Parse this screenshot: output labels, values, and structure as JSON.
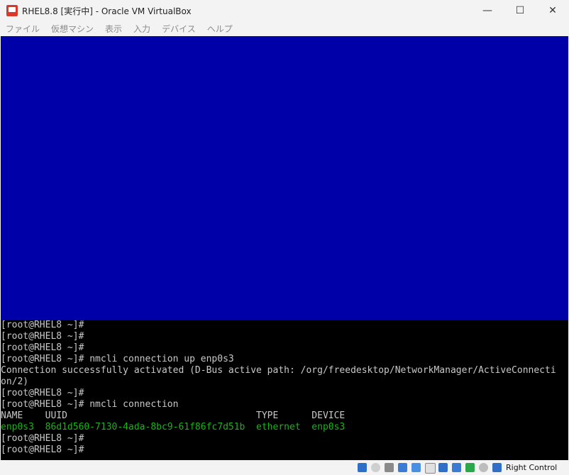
{
  "window": {
    "title": "RHEL8.8 [実行中] - Oracle VM VirtualBox",
    "controls": {
      "minimize": "—",
      "maximize": "☐",
      "close": "✕"
    }
  },
  "menu": [
    "ファイル",
    "仮想マシン",
    "表示",
    "入力",
    "デバイス",
    "ヘルプ"
  ],
  "terminal": {
    "lines": [
      "[root@RHEL8 ~]#",
      "[root@RHEL8 ~]#",
      "[root@RHEL8 ~]#",
      "[root@RHEL8 ~]# nmcli connection up enp0s3",
      "Connection successfully activated (D-Bus active path: /org/freedesktop/NetworkManager/ActiveConnecti",
      "on/2)",
      "[root@RHEL8 ~]#",
      "[root@RHEL8 ~]# nmcli connection",
      "NAME    UUID                                  TYPE      DEVICE",
      "enp0s3  86d1d560-7130-4ada-8bc9-61f86fc7d51b  ethernet  enp0s3",
      "[root@RHEL8 ~]#",
      "[root@RHEL8 ~]#"
    ],
    "highlight_line": 9
  },
  "statusbar": {
    "icons": [
      "hard-disk-icon",
      "optical-drive-icon",
      "audio-icon",
      "network-icon",
      "usb-icon",
      "shared-folders-icon",
      "display-icon",
      "recording-icon",
      "cpu-icon",
      "guest-additions-icon",
      "mouse-integration-icon",
      "host-key-arrow-icon"
    ],
    "host_key": "Right Control"
  },
  "colors": {
    "console_blue": "#0000a8",
    "console_text": "#c8c8c8",
    "console_green": "#19b419"
  }
}
